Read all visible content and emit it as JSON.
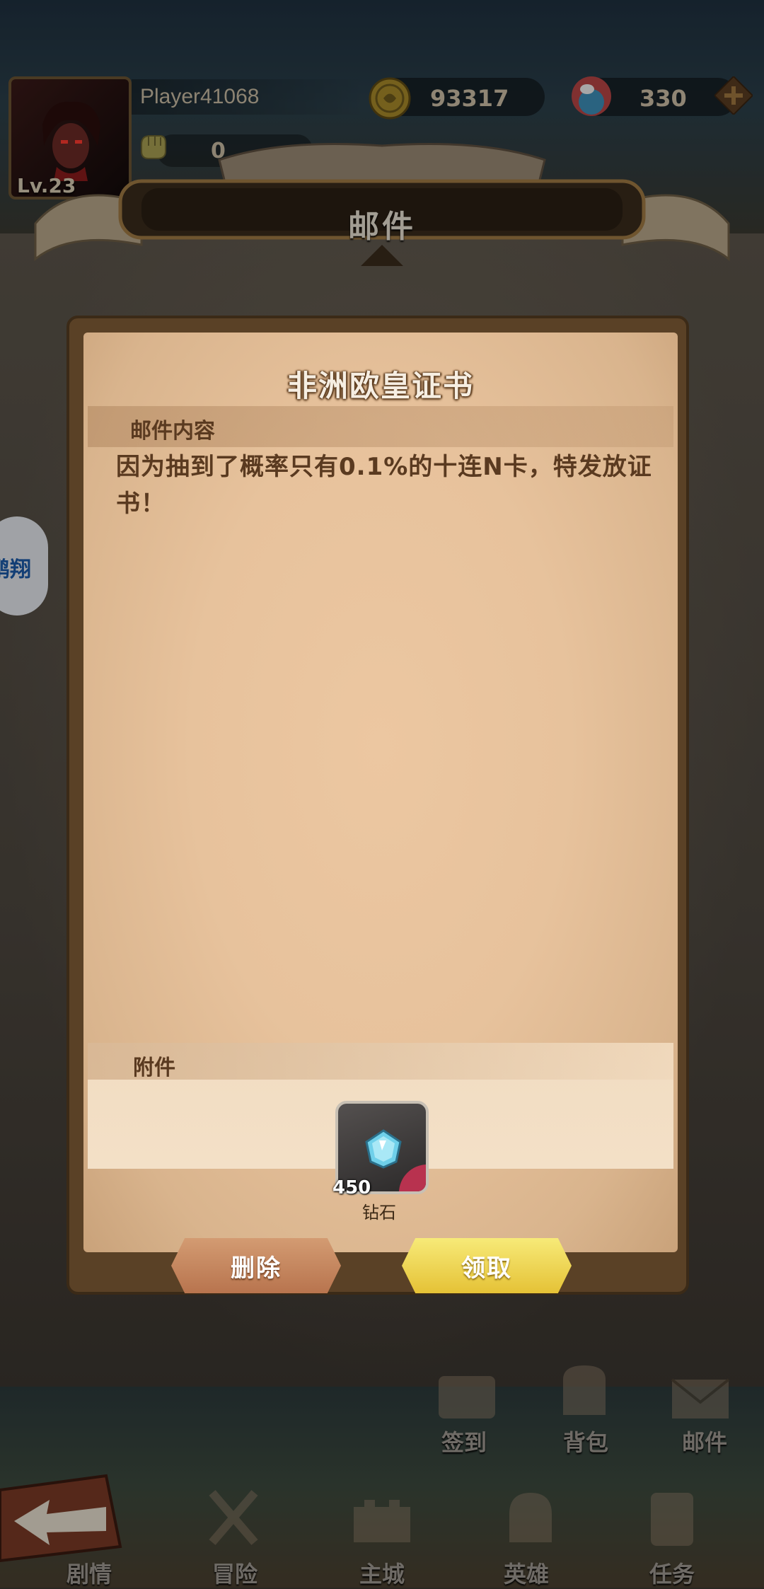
{
  "top_bar": {
    "player_name": "Player41068",
    "level": "Lv.23",
    "power": "0",
    "coins": "93317",
    "gems": "330"
  },
  "header": {
    "title": "邮件"
  },
  "mail": {
    "title": "非洲欧皇证书",
    "content_label": "邮件内容",
    "content_text": "因为抽到了概率只有0.1%的十连N卡，特发放证书！",
    "attachment_label": "附件",
    "attachment": {
      "count": "450",
      "name": "钻石",
      "icon": "diamond-icon"
    },
    "delete_label": "删除",
    "claim_label": "领取"
  },
  "side_widget": {
    "text": "鹏翔"
  },
  "bottom_nav": {
    "secondary": [
      {
        "label": "签到",
        "icon": "signin-icon"
      },
      {
        "label": "背包",
        "icon": "backpack-icon"
      },
      {
        "label": "邮件",
        "icon": "mail-icon"
      }
    ],
    "primary": [
      {
        "label": "剧情",
        "icon": "story-icon"
      },
      {
        "label": "冒险",
        "icon": "adventure-icon"
      },
      {
        "label": "主城",
        "icon": "castle-icon"
      },
      {
        "label": "英雄",
        "icon": "hero-icon"
      },
      {
        "label": "任务",
        "icon": "quest-icon"
      }
    ]
  },
  "colors": {
    "parchment": "#e7c29c",
    "frame": "#5a4126",
    "text_brown": "#5a3a20",
    "claim_button": "#f0d85a",
    "delete_button": "#c98960"
  }
}
